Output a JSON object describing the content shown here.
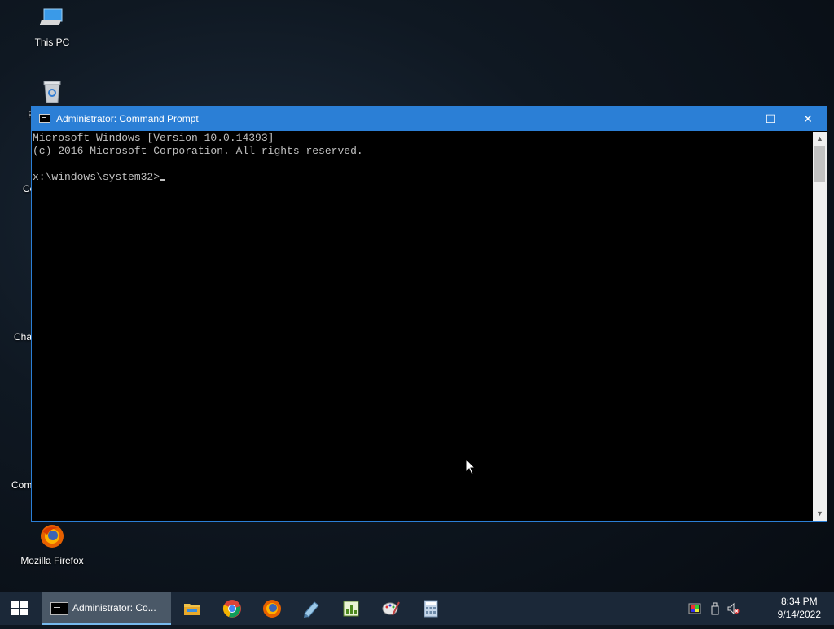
{
  "desktop": {
    "icons": [
      {
        "label": "This PC",
        "icon": "this-pc-icon"
      },
      {
        "label": "Mozilla Firefox",
        "icon": "firefox-icon"
      }
    ],
    "partial_labels": [
      "R",
      "Co",
      "Cha",
      "Com"
    ],
    "recycle_bin_icon": "recycle-bin-icon"
  },
  "window": {
    "title": "Administrator: Command Prompt",
    "buttons": {
      "minimize": "—",
      "maximize": "☐",
      "close": "✕"
    },
    "console_lines": [
      "Microsoft Windows [Version 10.0.14393]",
      "(c) 2016 Microsoft Corporation. All rights reserved.",
      "",
      "x:\\windows\\system32>"
    ]
  },
  "taskbar": {
    "active_task_label": "Administrator: Co...",
    "pinned": [
      "file-explorer-icon",
      "chrome-icon",
      "firefox-icon",
      "notepad-pen-icon",
      "spreadsheet-editor-icon",
      "paint-icon",
      "calculator-icon"
    ],
    "tray": [
      "color-icon",
      "usb-drive-icon",
      "volume-muted-icon"
    ],
    "time": "8:34 PM",
    "date": "9/14/2022"
  },
  "colors": {
    "titlebar": "#2b7fd6",
    "console_bg": "#000000",
    "console_text": "#c0c0c0",
    "taskbar": "#1b2838"
  }
}
